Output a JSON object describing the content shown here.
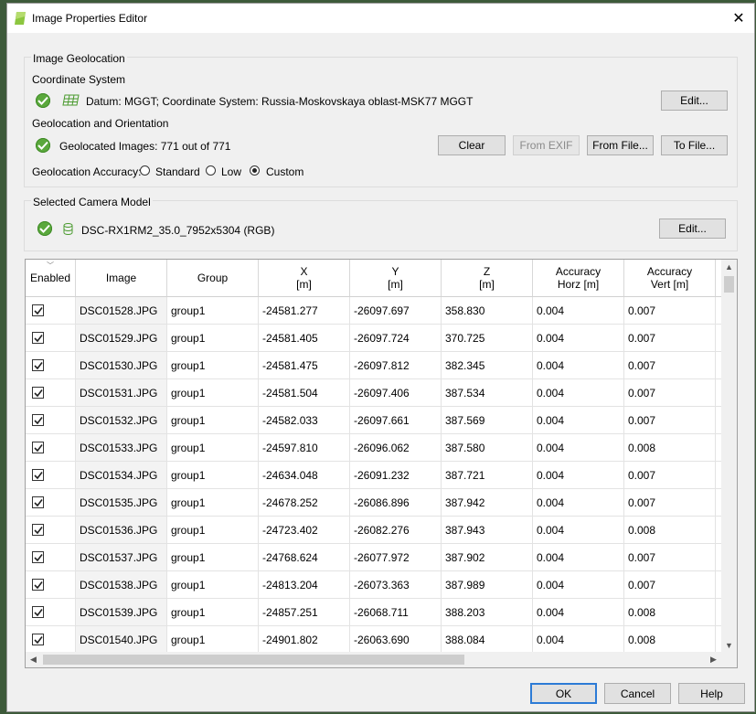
{
  "window": {
    "title": "Image Properties Editor"
  },
  "geolocation": {
    "group_label": "Image Geolocation",
    "coord_section_label": "Coordinate System",
    "coord_text": "Datum: MGGT; Coordinate System: Russia-Moskovskaya oblast-MSK77 MGGT",
    "coord_edit": "Edit...",
    "orient_section_label": "Geolocation and Orientation",
    "geolocated_text": "Geolocated Images: 771 out of 771",
    "buttons": {
      "clear": "Clear",
      "from_exif": "From EXIF",
      "from_file": "From File...",
      "to_file": "To File..."
    },
    "accuracy_label": "Geolocation Accuracy:",
    "accuracy_options": [
      "Standard",
      "Low",
      "Custom"
    ],
    "accuracy_selected": "Custom"
  },
  "camera": {
    "group_label": "Selected Camera Model",
    "model_text": "DSC-RX1RM2_35.0_7952x5304 (RGB)",
    "edit": "Edit..."
  },
  "table": {
    "headers": [
      {
        "line1": "Enabled",
        "line2": ""
      },
      {
        "line1": "Image",
        "line2": ""
      },
      {
        "line1": "Group",
        "line2": ""
      },
      {
        "line1": "X",
        "line2": "[m]"
      },
      {
        "line1": "Y",
        "line2": "[m]"
      },
      {
        "line1": "Z",
        "line2": "[m]"
      },
      {
        "line1": "Accuracy",
        "line2": "Horz [m]"
      },
      {
        "line1": "Accuracy",
        "line2": "Vert [m]"
      }
    ],
    "rows": [
      {
        "enabled": true,
        "image": "DSC01528.JPG",
        "group": "group1",
        "x": "-24581.277",
        "y": "-26097.697",
        "z": "358.830",
        "acc_h": "0.004",
        "acc_v": "0.007"
      },
      {
        "enabled": true,
        "image": "DSC01529.JPG",
        "group": "group1",
        "x": "-24581.405",
        "y": "-26097.724",
        "z": "370.725",
        "acc_h": "0.004",
        "acc_v": "0.007"
      },
      {
        "enabled": true,
        "image": "DSC01530.JPG",
        "group": "group1",
        "x": "-24581.475",
        "y": "-26097.812",
        "z": "382.345",
        "acc_h": "0.004",
        "acc_v": "0.007"
      },
      {
        "enabled": true,
        "image": "DSC01531.JPG",
        "group": "group1",
        "x": "-24581.504",
        "y": "-26097.406",
        "z": "387.534",
        "acc_h": "0.004",
        "acc_v": "0.007"
      },
      {
        "enabled": true,
        "image": "DSC01532.JPG",
        "group": "group1",
        "x": "-24582.033",
        "y": "-26097.661",
        "z": "387.569",
        "acc_h": "0.004",
        "acc_v": "0.007"
      },
      {
        "enabled": true,
        "image": "DSC01533.JPG",
        "group": "group1",
        "x": "-24597.810",
        "y": "-26096.062",
        "z": "387.580",
        "acc_h": "0.004",
        "acc_v": "0.008"
      },
      {
        "enabled": true,
        "image": "DSC01534.JPG",
        "group": "group1",
        "x": "-24634.048",
        "y": "-26091.232",
        "z": "387.721",
        "acc_h": "0.004",
        "acc_v": "0.007"
      },
      {
        "enabled": true,
        "image": "DSC01535.JPG",
        "group": "group1",
        "x": "-24678.252",
        "y": "-26086.896",
        "z": "387.942",
        "acc_h": "0.004",
        "acc_v": "0.007"
      },
      {
        "enabled": true,
        "image": "DSC01536.JPG",
        "group": "group1",
        "x": "-24723.402",
        "y": "-26082.276",
        "z": "387.943",
        "acc_h": "0.004",
        "acc_v": "0.008"
      },
      {
        "enabled": true,
        "image": "DSC01537.JPG",
        "group": "group1",
        "x": "-24768.624",
        "y": "-26077.972",
        "z": "387.902",
        "acc_h": "0.004",
        "acc_v": "0.007"
      },
      {
        "enabled": true,
        "image": "DSC01538.JPG",
        "group": "group1",
        "x": "-24813.204",
        "y": "-26073.363",
        "z": "387.989",
        "acc_h": "0.004",
        "acc_v": "0.007"
      },
      {
        "enabled": true,
        "image": "DSC01539.JPG",
        "group": "group1",
        "x": "-24857.251",
        "y": "-26068.711",
        "z": "388.203",
        "acc_h": "0.004",
        "acc_v": "0.008"
      },
      {
        "enabled": true,
        "image": "DSC01540.JPG",
        "group": "group1",
        "x": "-24901.802",
        "y": "-26063.690",
        "z": "388.084",
        "acc_h": "0.004",
        "acc_v": "0.008"
      },
      {
        "enabled": true,
        "image": "",
        "group": "",
        "x": "",
        "y": "",
        "z": "",
        "acc_h": "",
        "acc_v": ""
      }
    ]
  },
  "footer": {
    "ok": "OK",
    "cancel": "Cancel",
    "help": "Help"
  },
  "colors": {
    "accent": "#2c7bd6",
    "ok_icon": "#5aa83c",
    "app_icon": "#8cc63f"
  }
}
